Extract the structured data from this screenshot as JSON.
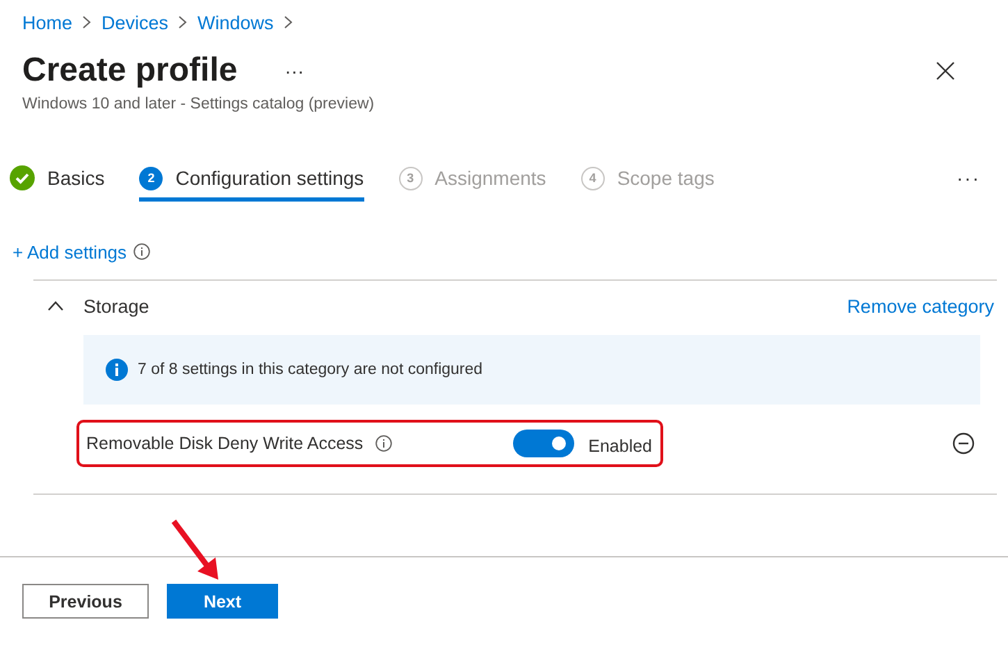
{
  "breadcrumb": [
    "Home",
    "Devices",
    "Windows"
  ],
  "title": "Create profile",
  "title_menu": "···",
  "subtitle": "Windows 10 and later - Settings catalog (preview)",
  "steps": [
    {
      "label": "Basics",
      "kind": "complete",
      "selected": false
    },
    {
      "number": "2",
      "label": "Configuration settings",
      "kind": "current",
      "selected": true
    },
    {
      "number": "3",
      "label": "Assignments",
      "kind": "pending",
      "selected": false
    },
    {
      "number": "4",
      "label": "Scope tags",
      "kind": "pending",
      "selected": false
    }
  ],
  "steps_menu": "···",
  "add_settings": "+ Add settings",
  "category": {
    "name": "Storage",
    "expanded": true,
    "remove_link": "Remove category",
    "info": "7 of 8 settings in this category are not configured",
    "settings": [
      {
        "label": "Removable Disk Deny Write Access",
        "on": true,
        "value": "Enabled",
        "highlighted": true
      }
    ]
  },
  "buttons": [
    {
      "label": "Previous",
      "kind": "secondary"
    },
    {
      "label": "Next",
      "kind": "primary",
      "pointed": true
    }
  ]
}
